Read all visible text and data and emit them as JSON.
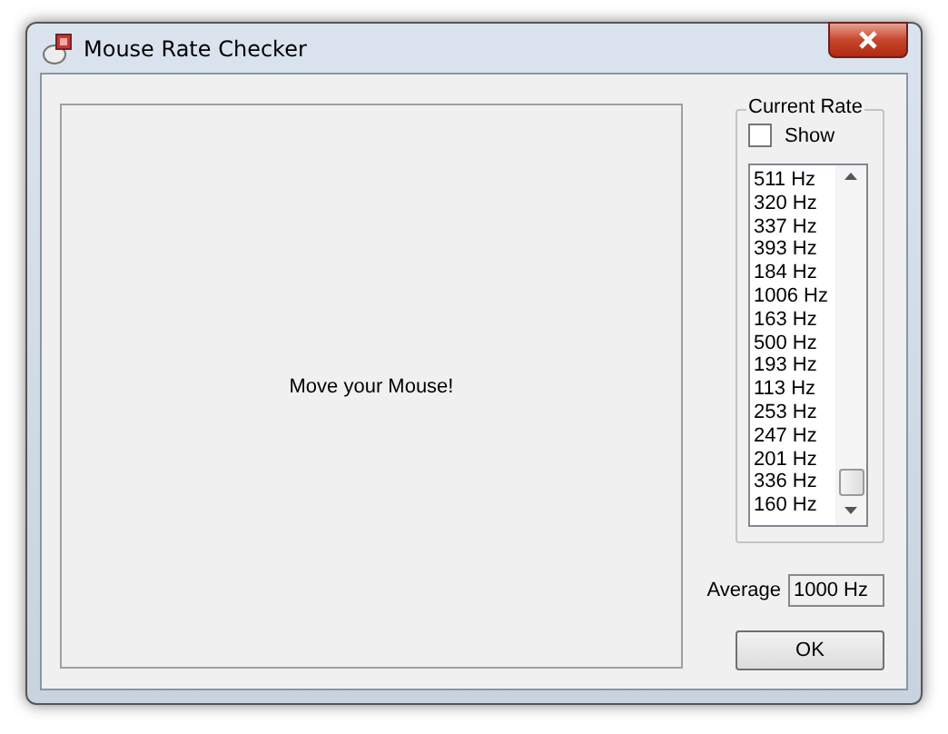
{
  "window": {
    "title": "Mouse Rate Checker"
  },
  "move_area": {
    "text": "Move your Mouse!"
  },
  "current_rate": {
    "title": "Current Rate",
    "show": {
      "label": "Show",
      "checked": false
    },
    "rates": [
      "511 Hz",
      "320 Hz",
      "337 Hz",
      "393 Hz",
      "184 Hz",
      "1006 Hz",
      "163 Hz",
      "500 Hz",
      "193 Hz",
      "113 Hz",
      "253 Hz",
      "247 Hz",
      "201 Hz",
      "336 Hz",
      "160 Hz"
    ]
  },
  "average": {
    "label": "Average",
    "value": "1000 Hz"
  },
  "buttons": [
    "OK"
  ]
}
